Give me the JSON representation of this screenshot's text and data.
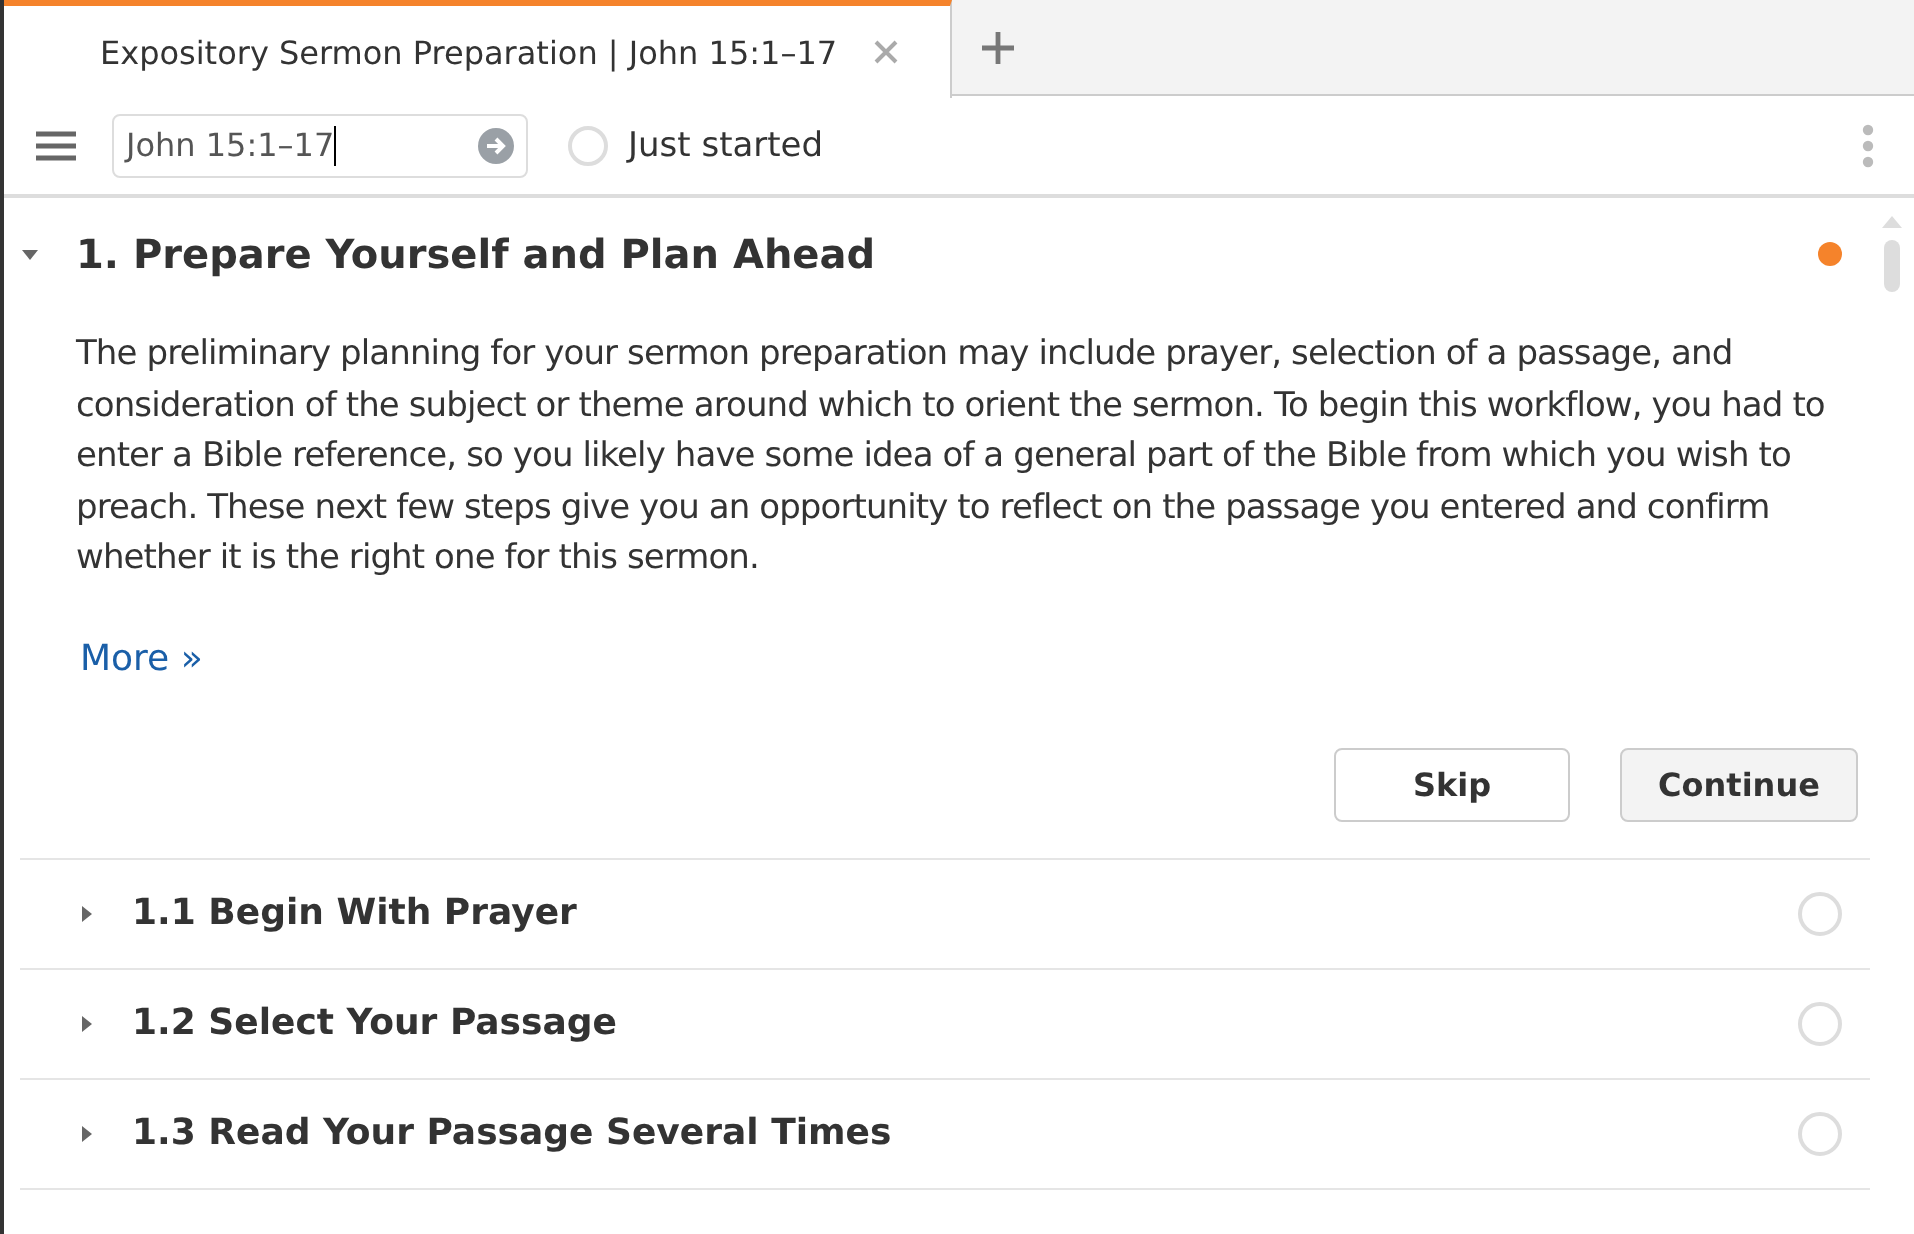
{
  "tabs": [
    {
      "label": "Expository Sermon Preparation | John 15:1–17",
      "selected": true
    }
  ],
  "toolbar": {
    "reference": "John 15:1–17",
    "status": "Just started",
    "status_checked": false
  },
  "section": {
    "title": "1. Prepare Yourself and Plan Ahead",
    "expanded": true,
    "color": "#f5832b",
    "body": "The preliminary planning for your sermon preparation may include prayer, selection of a passage, and consideration of the subject or theme around which to orient the sermon. To begin this workflow, you had to enter a Bible reference, so you likely have some idea of a general part of the Bible from which you wish to preach. These next few steps give you an opportunity to reflect on the passage you entered and confirm whether it is the right one for this sermon.",
    "more_link": "More »",
    "buttons": [
      "Skip",
      "Continue"
    ]
  },
  "steps": [
    {
      "title": "1.1 Begin With Prayer",
      "expanded": false,
      "done": false
    },
    {
      "title": "1.2 Select Your Passage",
      "expanded": false,
      "done": false
    },
    {
      "title": "1.3 Read Your Passage Several Times",
      "expanded": false,
      "done": false
    }
  ]
}
